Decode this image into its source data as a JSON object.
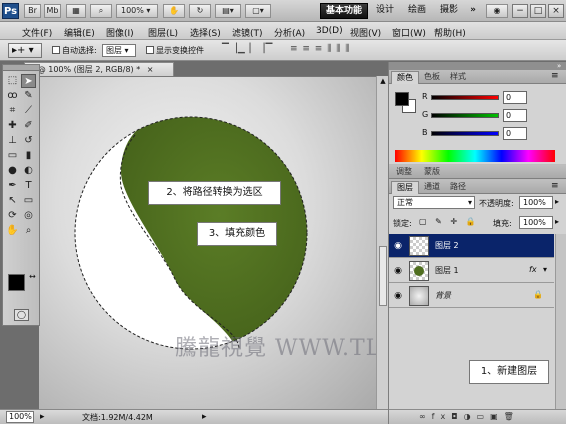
{
  "app": {
    "logo": "Ps",
    "mini_buttons": [
      "Br",
      "Mb"
    ],
    "zoom_display": "100%",
    "workspace": {
      "active": "基本功能",
      "others": [
        "设计",
        "绘画",
        "摄影"
      ],
      "more": "»"
    },
    "window_controls": [
      "−",
      "□",
      "×"
    ]
  },
  "menu": [
    "文件(F)",
    "编辑(E)",
    "图像(I)",
    "图层(L)",
    "选择(S)",
    "滤镜(T)",
    "分析(A)",
    "3D(D)",
    "视图(V)",
    "窗口(W)",
    "帮助(H)"
  ],
  "options_bar": {
    "auto_select_label": "自动选择:",
    "auto_select_value": "图层",
    "show_transform_label": "显示变换控件"
  },
  "document": {
    "tab_title": "D @ 100% (图层 2, RGB/8) *",
    "tab_close": "×",
    "zoom": "100%",
    "status": "文档:1.92M/4.42M"
  },
  "panels": {
    "color_tabs": [
      "颜色",
      "色板",
      "样式"
    ],
    "color": {
      "channels": [
        {
          "label": "R",
          "value": "0",
          "color": "#c00000"
        },
        {
          "label": "G",
          "value": "0",
          "color": "#00a000"
        },
        {
          "label": "B",
          "value": "0",
          "color": "#0000c0"
        }
      ]
    },
    "adjust_tabs": [
      "调整",
      "蒙版"
    ],
    "layers_tabs": [
      "图层",
      "通道",
      "路径"
    ],
    "blend_mode": "正常",
    "opacity_label": "不透明度:",
    "opacity_value": "100%",
    "lock_label": "锁定:",
    "fill_label": "填充:",
    "fill_value": "100%",
    "layers": [
      {
        "name": "图层 2",
        "selected": true,
        "fx": ""
      },
      {
        "name": "图层 1",
        "selected": false,
        "fx": "fx"
      },
      {
        "name": "背景",
        "selected": false,
        "fx": ""
      }
    ]
  },
  "callouts": {
    "step1": "1、新建图层",
    "step2": "2、将路径转换为选区",
    "step3": "3、填充颜色"
  },
  "watermark": "騰龍視覺 WWW.TLVI.NET",
  "colors": {
    "shape_green": "#4f6e20",
    "layer_selected": "#0a246a",
    "workspace_active": "#1a1a1a"
  }
}
